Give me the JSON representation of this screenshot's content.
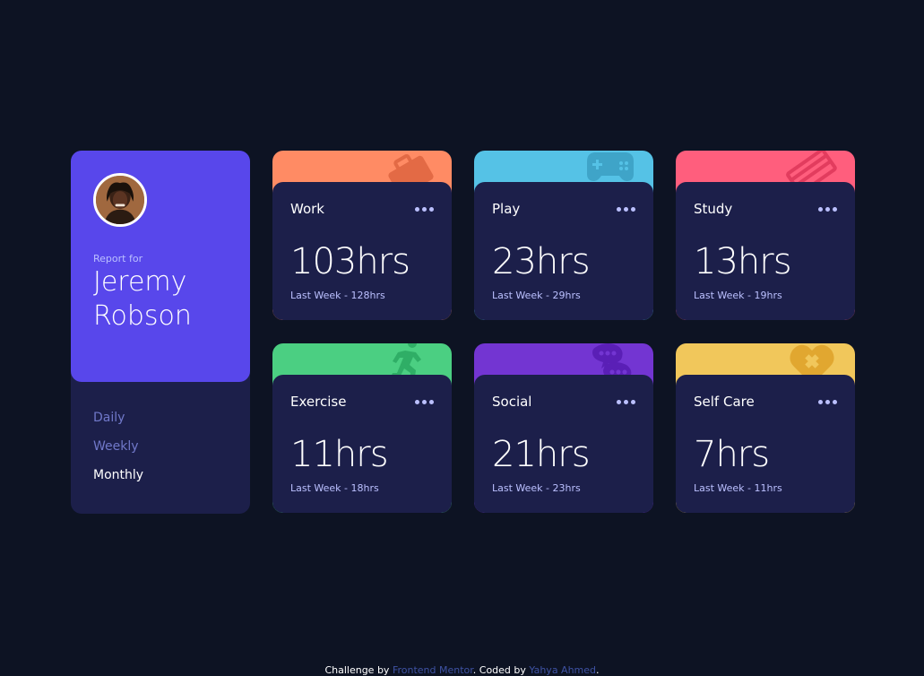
{
  "profile": {
    "report_label": "Report for",
    "name": "Jeremy Robson",
    "timeframes": [
      "Daily",
      "Weekly",
      "Monthly"
    ],
    "active_timeframe": "Monthly"
  },
  "cards": [
    {
      "title": "Work",
      "current": "103hrs",
      "previous": "Last Week - 128hrs",
      "color": "#ff8b64",
      "icon": "briefcase-icon"
    },
    {
      "title": "Play",
      "current": "23hrs",
      "previous": "Last Week - 29hrs",
      "color": "#55c2e6",
      "icon": "gamepad-icon"
    },
    {
      "title": "Study",
      "current": "13hrs",
      "previous": "Last Week - 19hrs",
      "color": "#ff5e7d",
      "icon": "book-icon"
    },
    {
      "title": "Exercise",
      "current": "11hrs",
      "previous": "Last Week - 18hrs",
      "color": "#4bcf82",
      "icon": "running-icon"
    },
    {
      "title": "Social",
      "current": "21hrs",
      "previous": "Last Week - 23hrs",
      "color": "#7335d2",
      "icon": "social-icon"
    },
    {
      "title": "Self Care",
      "current": "7hrs",
      "previous": "Last Week - 11hrs",
      "color": "#f1c75b",
      "icon": "self-care-icon"
    }
  ],
  "footer": {
    "prefix": "Challenge by ",
    "link1": "Frontend Mentor",
    "middle": ". Coded by ",
    "link2": "Yahya Ahmed",
    "suffix": "."
  },
  "colors": {
    "background": "#0d1323",
    "card": "#1c1f4a",
    "accent": "#5847eb",
    "muted": "#bbc0ff"
  }
}
